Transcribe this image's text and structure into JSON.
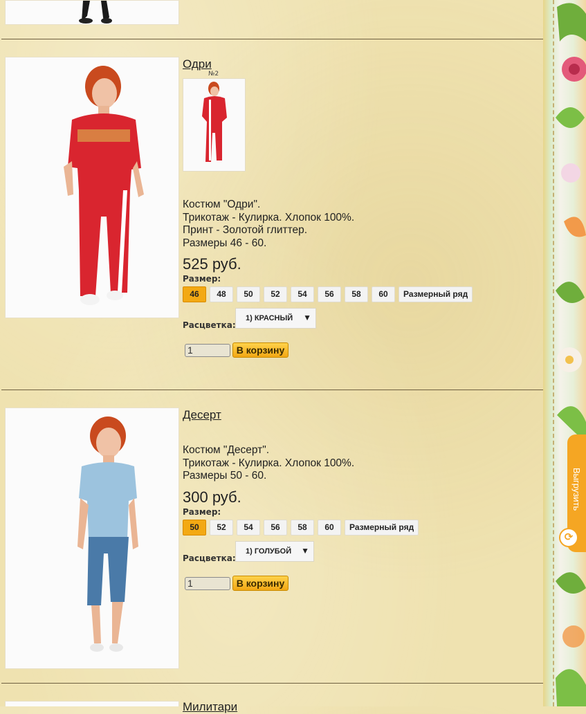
{
  "products": [
    {
      "title": "Одри",
      "thumb_label": "№2",
      "description": [
        "Костюм \"Одри\".",
        "Трикотаж - Кулирка. Хлопок 100%.",
        "Принт - Золотой глиттер.",
        "Размеры 46 - 60."
      ],
      "price": "525 руб.",
      "size_label": "Размер:",
      "sizes": [
        "46",
        "48",
        "50",
        "52",
        "54",
        "56",
        "58",
        "60"
      ],
      "active_size": "46",
      "size_chart_label": "Размерный ряд",
      "color_label": "Расцветка:",
      "color_value": "1) КРАСНЫЙ",
      "quantity": "1",
      "cart_label": "В корзину",
      "garment_color": "#d9252f"
    },
    {
      "title": "Десерт",
      "description": [
        "Костюм \"Десерт\".",
        "Трикотаж - Кулирка. Хлопок 100%.",
        "Размеры 50 - 60."
      ],
      "price": "300 руб.",
      "size_label": "Размер:",
      "sizes": [
        "50",
        "52",
        "54",
        "56",
        "58",
        "60"
      ],
      "active_size": "50",
      "size_chart_label": "Размерный ряд",
      "color_label": "Расцветка:",
      "color_value": "1) ГОЛУБОЙ",
      "quantity": "1",
      "cart_label": "В корзину",
      "garment_color": "#9cc3de"
    }
  ],
  "next_product_title": "Милитари",
  "sidebar": {
    "export_label": "Выгрузить",
    "export_icon": "sync-icon",
    "accent": "#f5a623"
  },
  "colors": {
    "active_size": "#f3a913",
    "cart_button": "#f2a714",
    "background": "#efe2b0"
  }
}
